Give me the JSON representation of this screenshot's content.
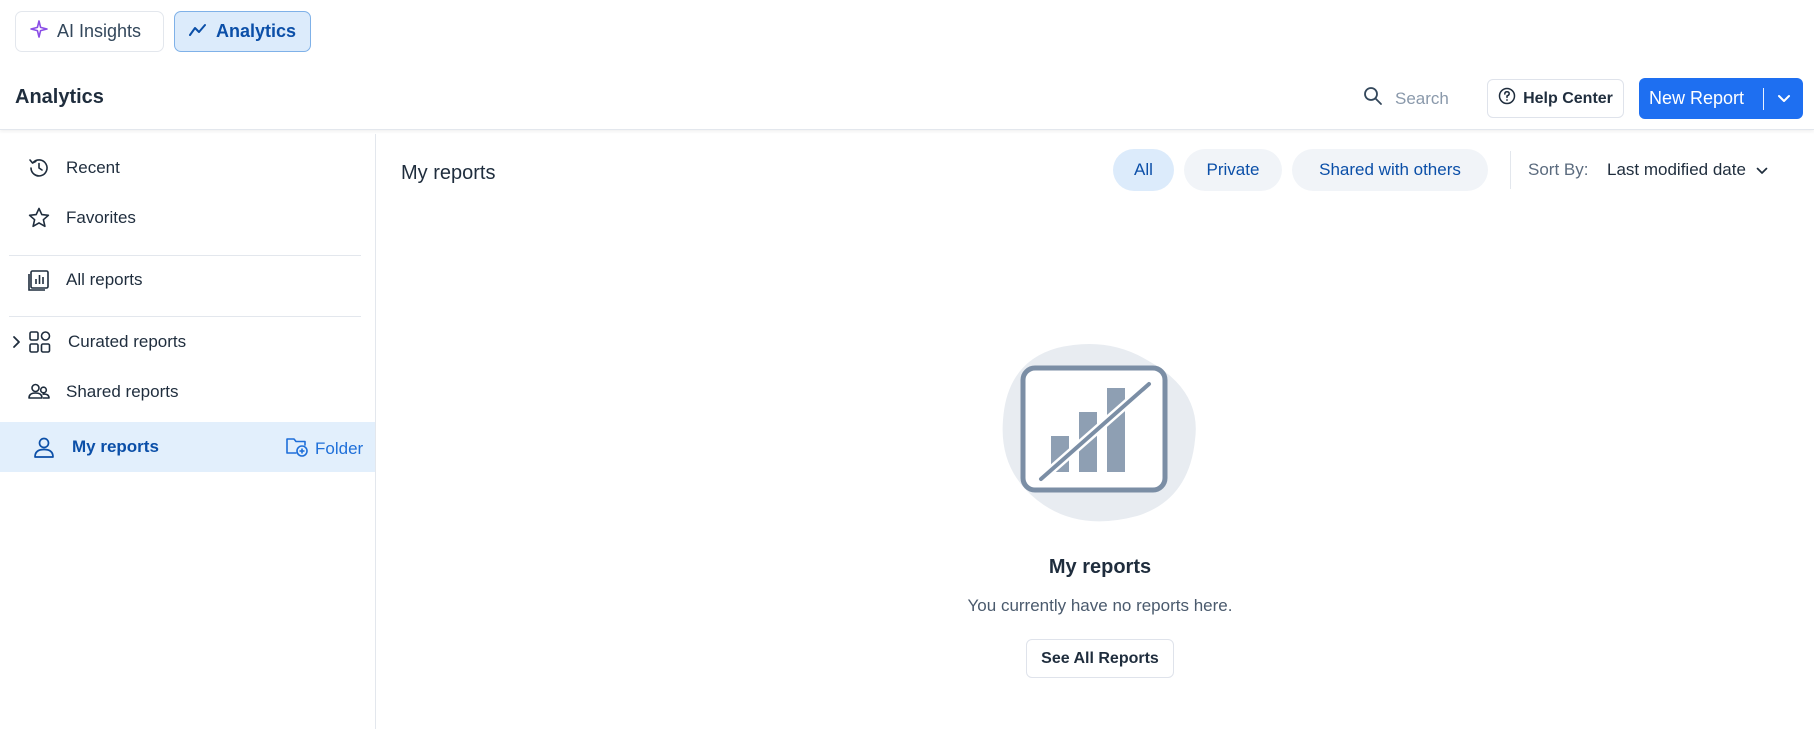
{
  "tabs": [
    {
      "label": "AI Insights",
      "icon": "sparkle-icon",
      "active": false
    },
    {
      "label": "Analytics",
      "icon": "trend-line-icon",
      "active": true
    }
  ],
  "header": {
    "title": "Analytics",
    "search_placeholder": "Search",
    "help_label": "Help Center",
    "new_report_label": "New Report"
  },
  "sidebar": {
    "items": [
      {
        "label": "Recent",
        "icon": "history-icon"
      },
      {
        "label": "Favorites",
        "icon": "star-icon"
      },
      {
        "label": "All reports",
        "icon": "report-chart-icon"
      },
      {
        "label": "Curated reports",
        "icon": "shapes-icon",
        "expandable": true
      },
      {
        "label": "Shared reports",
        "icon": "people-icon"
      },
      {
        "label": "My reports",
        "icon": "person-icon",
        "active": true
      }
    ],
    "folder_label": "Folder"
  },
  "main": {
    "title": "My reports",
    "filters": [
      "All",
      "Private",
      "Shared with others"
    ],
    "active_filter": "All",
    "sort_label": "Sort By:",
    "sort_value": "Last modified date"
  },
  "empty_state": {
    "title": "My reports",
    "message": "You currently have no reports here.",
    "button_label": "See All Reports"
  },
  "colors": {
    "accent": "#1e6ff1",
    "active_bg": "#dcebfb",
    "active_text": "#0b4fa8",
    "ai_icon": "#8a4de6"
  }
}
